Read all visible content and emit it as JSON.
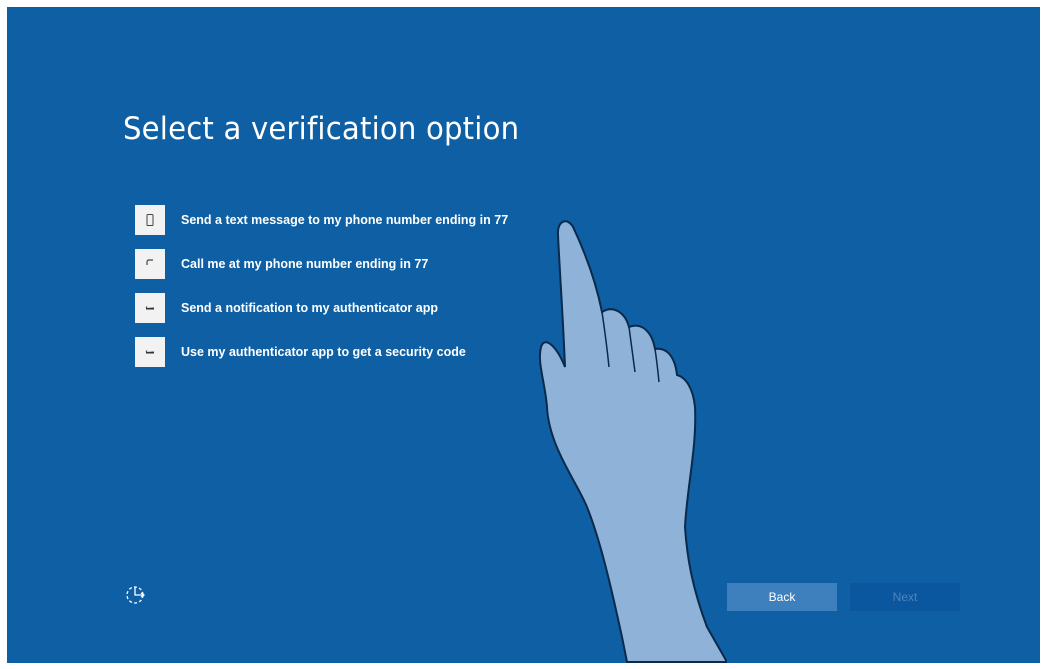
{
  "page": {
    "title": "Select a verification option"
  },
  "options": [
    {
      "label": "Send a text message to my phone number ending in 77",
      "icon": "phone-icon"
    },
    {
      "label": "Call me at my phone number ending in 77",
      "icon": "call-icon"
    },
    {
      "label": "Send a notification to my authenticator app",
      "icon": "authenticator-icon"
    },
    {
      "label": "Use my authenticator app to get a security code",
      "icon": "authenticator-icon"
    }
  ],
  "footer": {
    "back_label": "Back",
    "next_label": "Next"
  },
  "colors": {
    "background": "#0e5fa4",
    "icon_tile": "#f2f2f2",
    "back_button": "#3d80bd",
    "next_button": "#0a57a0",
    "hand_fill": "#8fb3d8"
  }
}
